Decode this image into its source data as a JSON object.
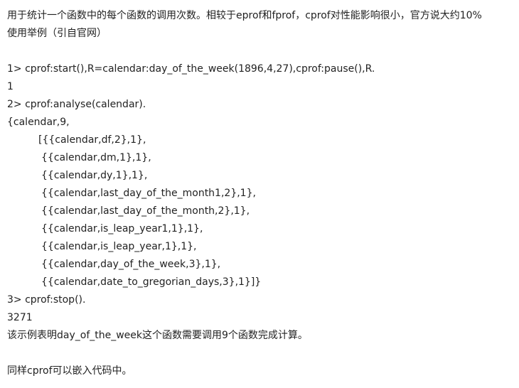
{
  "intro": {
    "line1": "用于统计一个函数中的每个函数的调用次数。相较于eprof和fprof，cprof对性能影响很小，官方说大约10%",
    "line2": "使用举例（引自官网）"
  },
  "example": {
    "cmd1": "1> cprof:start(),R=calendar:day_of_the_week(1896,4,27),cprof:pause(),R.",
    "out1": "1",
    "cmd2": "2> cprof:analyse(calendar).",
    "out2_head": "{calendar,9,",
    "out2_items": [
      "[{{calendar,df,2},1},",
      "{{calendar,dm,1},1},",
      "{{calendar,dy,1},1},",
      "{{calendar,last_day_of_the_month1,2},1},",
      "{{calendar,last_day_of_the_month,2},1},",
      "{{calendar,is_leap_year1,1},1},",
      "{{calendar,is_leap_year,1},1},",
      "{{calendar,day_of_the_week,3},1},",
      "{{calendar,date_to_gregorian_days,3},1}]}"
    ],
    "cmd3": "3> cprof:stop().",
    "out3": "3271"
  },
  "conclusion": "该示例表明day_of_the_week这个函数需要调用9个函数完成计算。",
  "footer": "同样cprof可以嵌入代码中。"
}
